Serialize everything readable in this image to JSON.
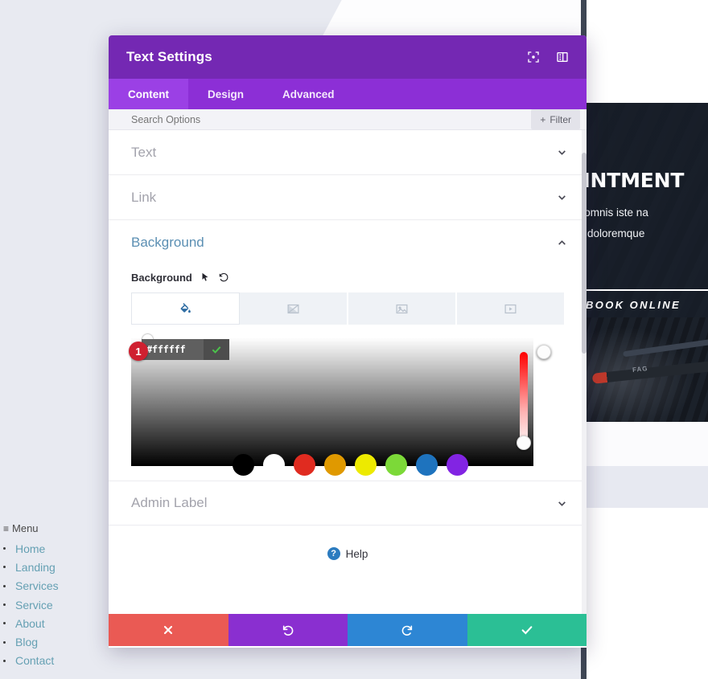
{
  "modal": {
    "title": "Text Settings",
    "header_icons": [
      {
        "name": "expand-icon"
      },
      {
        "name": "panel-layout-icon"
      }
    ],
    "tabs": [
      {
        "label": "Content",
        "active": true
      },
      {
        "label": "Design",
        "active": false
      },
      {
        "label": "Advanced",
        "active": false
      }
    ],
    "search": {
      "placeholder": "Search Options",
      "filter_label": "Filter",
      "filter_plus": "+"
    },
    "sections": [
      {
        "label": "Text",
        "open": false
      },
      {
        "label": "Link",
        "open": false
      },
      {
        "label": "Background",
        "open": true
      },
      {
        "label": "Admin Label",
        "open": false
      }
    ],
    "background": {
      "field_label": "Background",
      "types": [
        {
          "name": "background-color-tab",
          "active": true
        },
        {
          "name": "background-gradient-tab",
          "active": false
        },
        {
          "name": "background-image-tab",
          "active": false
        },
        {
          "name": "background-video-tab",
          "active": false
        }
      ],
      "hex_value": "#ffffff",
      "badge": "1",
      "swatches": [
        "#000000",
        "#ffffff",
        "#e02b20",
        "#e09900",
        "#edea00",
        "#7cd938",
        "#1e73be",
        "#8224e3"
      ]
    },
    "help": {
      "label": "Help",
      "glyph": "?"
    },
    "actions": [
      {
        "name": "cancel-button",
        "color": "#ea5a54"
      },
      {
        "name": "undo-button",
        "color": "#8a2fd0"
      },
      {
        "name": "redo-button",
        "color": "#2d86d4"
      },
      {
        "name": "save-button",
        "color": "#2bbf95"
      }
    ]
  },
  "site": {
    "hero": {
      "heading": "APPOINTMENT",
      "line1": "ciatis unde omnis iste na",
      "line2": "ccusantium doloremque",
      "button": "BOOK ONLINE"
    },
    "tool_text": "FAG"
  },
  "menu": {
    "title": "Menu",
    "burger": "≡",
    "items": [
      {
        "label": "Home"
      },
      {
        "label": "Landing"
      },
      {
        "label": "Services"
      },
      {
        "label": "Service"
      },
      {
        "label": "About"
      },
      {
        "label": "Blog"
      },
      {
        "label": "Contact"
      }
    ]
  },
  "colors": {
    "modal_header": "#7428b3",
    "tabbar": "#8c2fd6",
    "tab_active": "#9b40e5",
    "section_open": "#5b8fb3",
    "badge": "#cf2030"
  }
}
